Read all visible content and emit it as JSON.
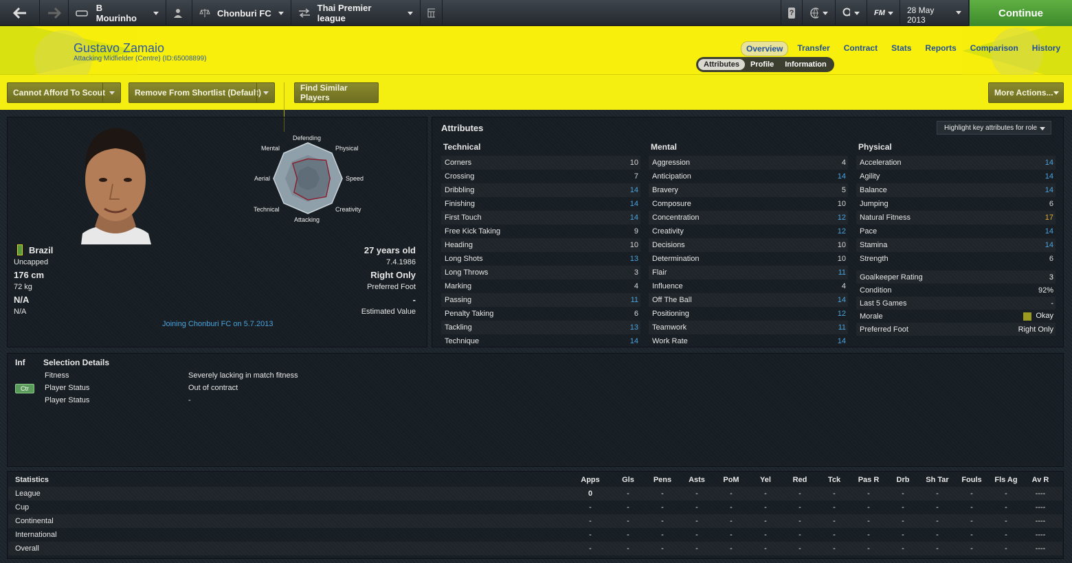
{
  "topbar": {
    "manager": "B Mourinho",
    "club": "Chonburi FC",
    "league": "Thai Premier league",
    "date": "28 May 2013",
    "continue_label": "Continue",
    "fm_label": "FM"
  },
  "player": {
    "name": "Gustavo Zamaio",
    "position": "Attacking Midfielder (Centre) (ID:65008899)"
  },
  "tabs": [
    "Overview",
    "Transfer",
    "Contract",
    "Stats",
    "Reports",
    "Comparison",
    "History"
  ],
  "subtabs": [
    "Attributes",
    "Profile",
    "Information"
  ],
  "actions": {
    "scout": "Cannot Afford To Scout",
    "shortlist": "Remove From Shortlist (Default)",
    "similar": "Find Similar Players",
    "more": "More Actions..."
  },
  "radar": {
    "labels": [
      "Defending",
      "Physical",
      "Speed",
      "Creativity",
      "Attacking",
      "Technical",
      "Aerial",
      "Mental"
    ],
    "levels": [
      0.55,
      0.72,
      0.62,
      0.72,
      0.6,
      0.55,
      0.3,
      0.6
    ]
  },
  "info": {
    "nation": "Brazil",
    "caps": "Uncapped",
    "height": "176 cm",
    "weight": "72 kg",
    "na1": "N/A",
    "na2": "N/A",
    "age": "27 years old",
    "dob": "7.4.1986",
    "foot": "Right Only",
    "foot_label": "Preferred Foot",
    "value": "-",
    "value_label": "Estimated Value",
    "joining": "Joining Chonburi FC on 5.7.2013"
  },
  "attributes": {
    "title": "Attributes",
    "highlight": "Highlight key attributes for role",
    "technical": {
      "title": "Technical",
      "rows": [
        [
          "Corners",
          "10",
          "grey"
        ],
        [
          "Crossing",
          "7",
          "grey"
        ],
        [
          "Dribbling",
          "14",
          "blue"
        ],
        [
          "Finishing",
          "14",
          "blue"
        ],
        [
          "First Touch",
          "14",
          "blue"
        ],
        [
          "Free Kick Taking",
          "9",
          "grey"
        ],
        [
          "Heading",
          "10",
          "grey"
        ],
        [
          "Long Shots",
          "13",
          "blue"
        ],
        [
          "Long Throws",
          "3",
          "grey"
        ],
        [
          "Marking",
          "4",
          "grey"
        ],
        [
          "Passing",
          "11",
          "blue"
        ],
        [
          "Penalty Taking",
          "6",
          "grey"
        ],
        [
          "Tackling",
          "13",
          "blue"
        ],
        [
          "Technique",
          "14",
          "blue"
        ]
      ]
    },
    "mental": {
      "title": "Mental",
      "rows": [
        [
          "Aggression",
          "4",
          "grey"
        ],
        [
          "Anticipation",
          "14",
          "blue"
        ],
        [
          "Bravery",
          "5",
          "grey"
        ],
        [
          "Composure",
          "10",
          "grey"
        ],
        [
          "Concentration",
          "12",
          "blue"
        ],
        [
          "Creativity",
          "12",
          "blue"
        ],
        [
          "Decisions",
          "10",
          "grey"
        ],
        [
          "Determination",
          "10",
          "grey"
        ],
        [
          "Flair",
          "11",
          "blue"
        ],
        [
          "Influence",
          "4",
          "grey"
        ],
        [
          "Off The Ball",
          "14",
          "blue"
        ],
        [
          "Positioning",
          "12",
          "blue"
        ],
        [
          "Teamwork",
          "11",
          "blue"
        ],
        [
          "Work Rate",
          "14",
          "blue"
        ]
      ]
    },
    "physical": {
      "title": "Physical",
      "rows": [
        [
          "Acceleration",
          "14",
          "blue"
        ],
        [
          "Agility",
          "14",
          "blue"
        ],
        [
          "Balance",
          "14",
          "blue"
        ],
        [
          "Jumping",
          "6",
          "grey"
        ],
        [
          "Natural Fitness",
          "17",
          "gold"
        ],
        [
          "Pace",
          "14",
          "blue"
        ],
        [
          "Stamina",
          "14",
          "blue"
        ],
        [
          "Strength",
          "6",
          "grey"
        ]
      ]
    },
    "extra": [
      [
        "Goalkeeper Rating",
        "3"
      ],
      [
        "Condition",
        "92%"
      ],
      [
        "Last 5 Games",
        "-"
      ],
      [
        "Morale",
        "Okay"
      ],
      [
        "Preferred Foot",
        "Right Only"
      ]
    ]
  },
  "selection": {
    "inf": "Inf",
    "title": "Selection Details",
    "badge": "Ctr",
    "rows": [
      [
        "Fitness",
        "Severely lacking in match fitness"
      ],
      [
        "Player Status",
        "Out of contract"
      ],
      [
        "Player Status",
        "-"
      ]
    ]
  },
  "statistics": {
    "title": "Statistics",
    "headers": [
      "Apps",
      "Gls",
      "Pens",
      "Asts",
      "PoM",
      "Yel",
      "Red",
      "Tck",
      "Pas R",
      "Drb",
      "Sh Tar",
      "Fouls",
      "Fls Ag",
      "Av R"
    ],
    "rows": [
      [
        "League",
        [
          "0",
          "-",
          "-",
          "-",
          "-",
          "-",
          "-",
          "-",
          "-",
          "-",
          "-",
          "-",
          "-",
          "----"
        ]
      ],
      [
        "Cup",
        [
          "-",
          "-",
          "-",
          "-",
          "-",
          "-",
          "-",
          "-",
          "-",
          "-",
          "-",
          "-",
          "-",
          "----"
        ]
      ],
      [
        "Continental",
        [
          "-",
          "-",
          "-",
          "-",
          "-",
          "-",
          "-",
          "-",
          "-",
          "-",
          "-",
          "-",
          "-",
          "----"
        ]
      ],
      [
        "International",
        [
          "-",
          "-",
          "-",
          "-",
          "-",
          "-",
          "-",
          "-",
          "-",
          "-",
          "-",
          "-",
          "-",
          "----"
        ]
      ],
      [
        "Overall",
        [
          "-",
          "-",
          "-",
          "-",
          "-",
          "-",
          "-",
          "-",
          "-",
          "-",
          "-",
          "-",
          "-",
          "----"
        ]
      ]
    ]
  },
  "colors": {
    "header_yellow": "#f5ee11",
    "link_blue": "#1f4f9c",
    "continue_green": "#4e9e36",
    "attr_blue": "#4aa4e0"
  }
}
